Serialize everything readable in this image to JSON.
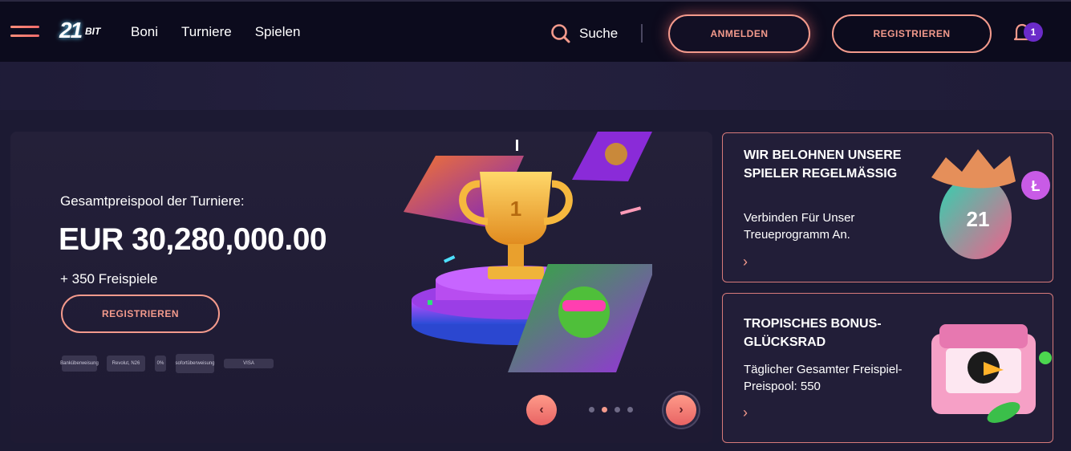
{
  "header": {
    "nav": [
      "Boni",
      "Turniere",
      "Spielen"
    ],
    "search_label": "Suche",
    "login_label": "ANMELDEN",
    "register_label": "REGISTRIEREN",
    "notification_count": "1",
    "logo_num": "21",
    "logo_bit": "BIT"
  },
  "hero": {
    "subtitle": "Gesamtpreispool der Turniere:",
    "amount": "EUR 30,280,000.00",
    "spins": "+ 350 Freispiele",
    "button_label": "REGISTRIEREN",
    "payment_labels": [
      "Banküberweisung",
      "Revolut, N26",
      "0%",
      "sofortüberweisung",
      "VISA"
    ]
  },
  "promos": [
    {
      "title": "WIR BELOHNEN UNSERE SPIELER REGELMÄSSIG",
      "desc": "Verbinden Für Unser Treueprogramm An.",
      "coin_label": "21"
    },
    {
      "title": "TROPISCHES BONUS-GLÜCKSRAD",
      "desc": "Täglicher Gesamter Freispiel-Preispool: 550"
    }
  ],
  "carousel": {
    "slides": 4,
    "active": 1
  },
  "colors": {
    "accent": "#f39a8c",
    "badge": "#6b2bc9",
    "header_bg": "#0c0b1d"
  }
}
